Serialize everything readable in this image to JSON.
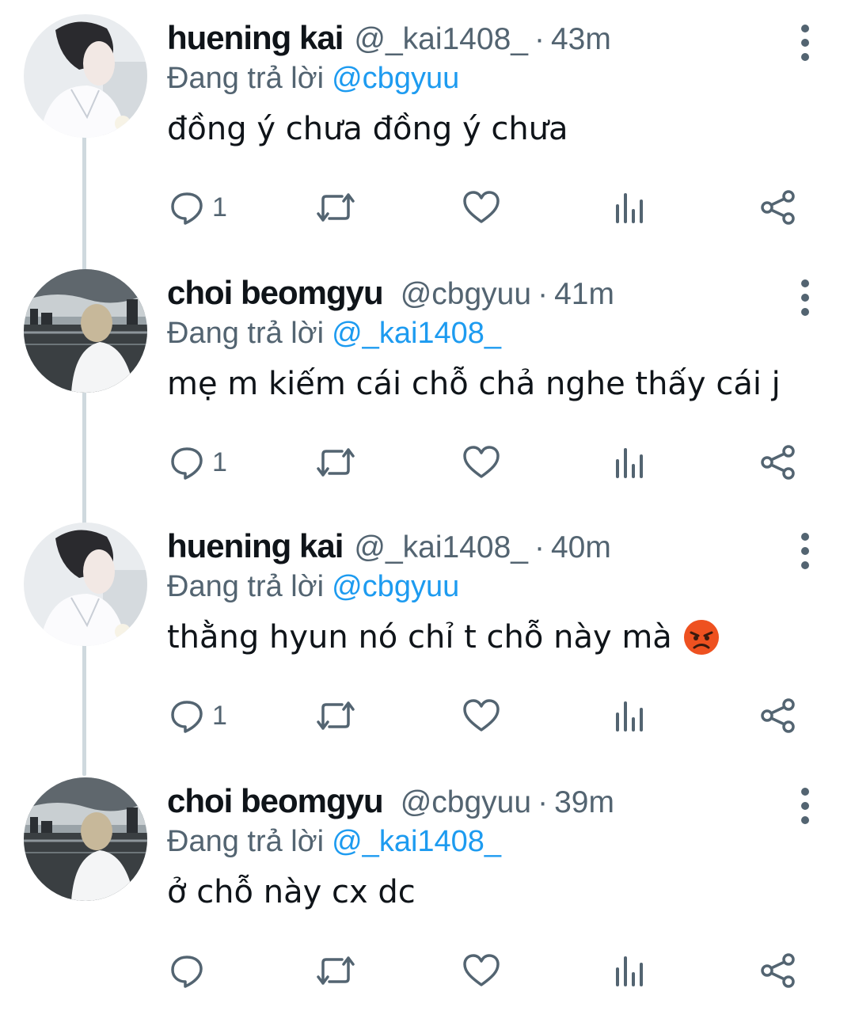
{
  "colors": {
    "name": "#0f1419",
    "secondary": "#536471",
    "mention": "#1d9bf0",
    "icon": "#536471",
    "thread_line": "#cfd9de"
  },
  "replying_label": "Đang trả lời",
  "tweets": [
    {
      "name": "huening kai",
      "handle": "@_kai1408_",
      "separator": "·",
      "time": "43m",
      "reply_to": "@cbgyuu",
      "text": "đồng ý chưa đồng ý chưa",
      "reply_count": "1",
      "avatar": "huening-kai-avatar"
    },
    {
      "name": "choi beomgyu",
      "handle": "@cbgyuu",
      "separator": "·",
      "time": "41m",
      "reply_to": "@_kai1408_",
      "text": "mẹ m kiếm cái chỗ chả nghe thấy cái j",
      "reply_count": "1",
      "avatar": "choi-beomgyu-avatar"
    },
    {
      "name": "huening kai",
      "handle": "@_kai1408_",
      "separator": "·",
      "time": "40m",
      "reply_to": "@cbgyuu",
      "text": "thằng hyun nó chỉ t chỗ này mà",
      "emoji": "angry-face-emoji",
      "reply_count": "1",
      "avatar": "huening-kai-avatar"
    },
    {
      "name": "choi beomgyu",
      "handle": "@cbgyuu",
      "separator": "·",
      "time": "39m",
      "reply_to": "@_kai1408_",
      "text": "ở chỗ này cx dc",
      "reply_count": "",
      "avatar": "choi-beomgyu-avatar"
    }
  ]
}
